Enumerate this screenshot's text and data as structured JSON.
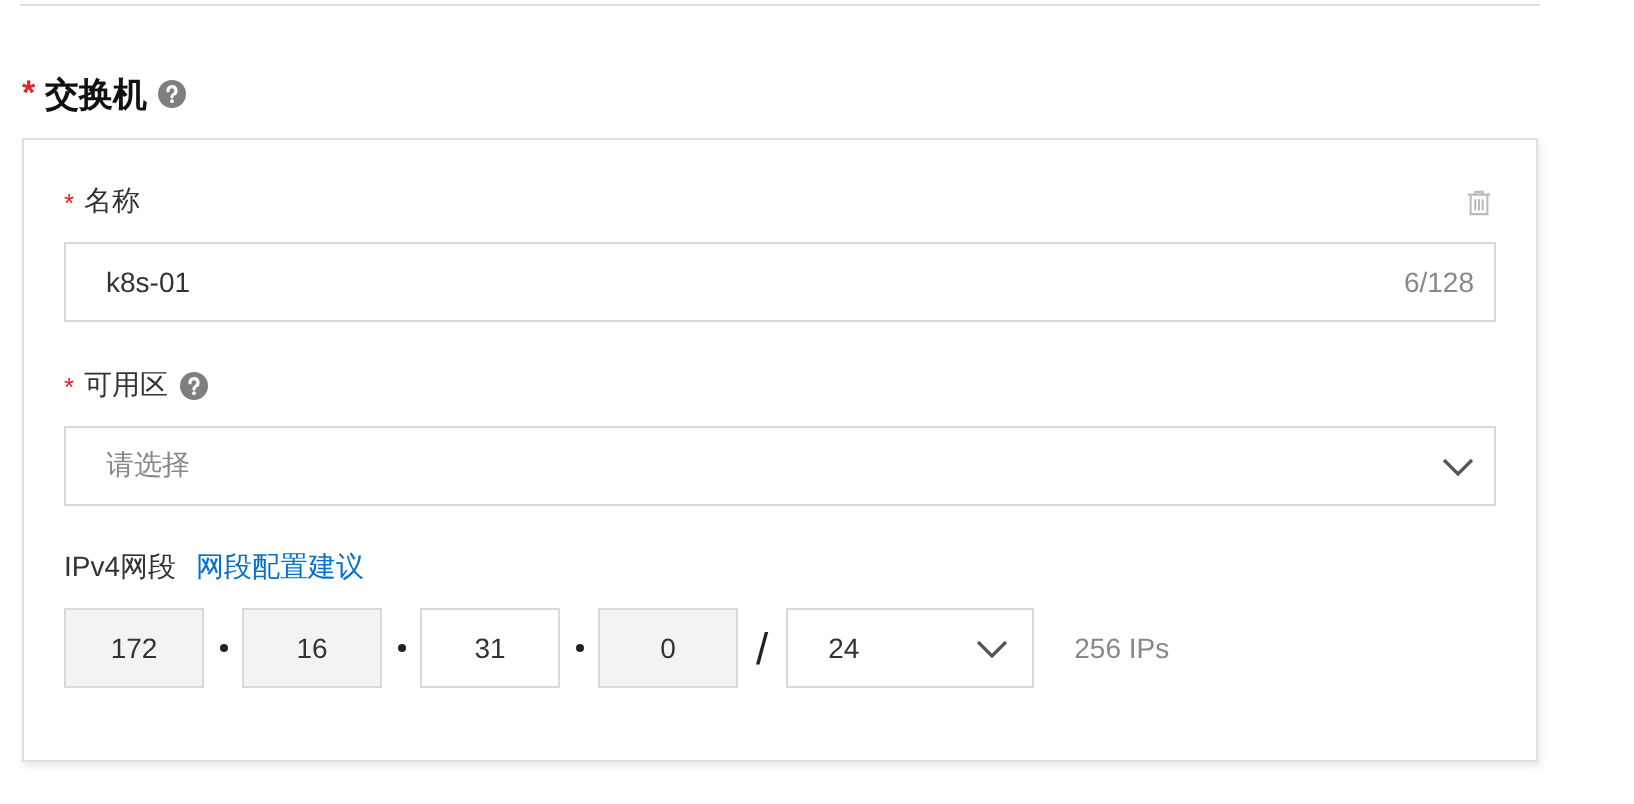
{
  "section": {
    "mark": "*",
    "title": "交换机"
  },
  "name_field": {
    "mark": "*",
    "label": "名称",
    "value": "k8s-01",
    "counter": "6/128"
  },
  "zone_field": {
    "mark": "*",
    "label": "可用区",
    "placeholder": "请选择"
  },
  "cidr": {
    "label": "IPv4网段",
    "link": "网段配置建议",
    "octets": [
      {
        "value": "172",
        "disabled": true
      },
      {
        "value": "16",
        "disabled": true
      },
      {
        "value": "31",
        "disabled": false
      },
      {
        "value": "0",
        "disabled": true
      }
    ],
    "separator": "/",
    "prefix": "24",
    "count": "256 IPs"
  }
}
